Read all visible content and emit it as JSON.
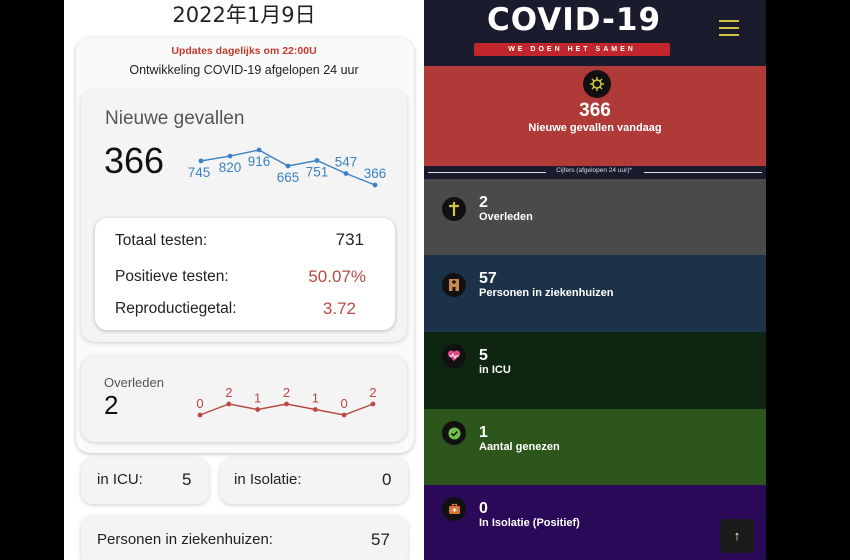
{
  "left": {
    "date": "2022年1月9日",
    "updates": "Updates dagelijks om 22:00U",
    "subtitle": "Ontwikkeling COVID-19 afgelopen 24 uur",
    "nieuwe": {
      "label": "Nieuwe gevallen",
      "value": "366",
      "trend": [
        "745",
        "820",
        "916",
        "665",
        "751",
        "547",
        "366"
      ]
    },
    "tests": {
      "totaal_label": "Totaal testen:",
      "totaal_value": "731",
      "positief_label": "Positieve testen:",
      "positief_value": "50.07%",
      "repro_label": "Reproductiegetal:",
      "repro_value": "3.72"
    },
    "overleden": {
      "label": "Overleden",
      "value": "2",
      "trend": [
        "0",
        "2",
        "1",
        "2",
        "1",
        "0",
        "2"
      ]
    },
    "icu": {
      "label": "in ICU:",
      "value": "5"
    },
    "isolatie": {
      "label": "in Isolatie:",
      "value": "0"
    },
    "ziekenhuis": {
      "label": "Personen in ziekenhuizen:",
      "value": "57"
    },
    "colors": {
      "line_blue": "#3b82c4",
      "line_red": "#b84a45",
      "accent_red": "#c0392b"
    }
  },
  "right": {
    "title": "COVID-19",
    "tagline": "WE DOEN HET SAMEN",
    "hero": {
      "value": "366",
      "label": "Nieuwe gevallen vandaag",
      "icon": "virus-icon",
      "color": "#b03a37"
    },
    "divider": "Cijfers (afgelopen 24 uur)*",
    "stats": [
      {
        "value": "2",
        "label": "Overleden",
        "icon": "cross-icon",
        "color": "#4a4a4a"
      },
      {
        "value": "57",
        "label": "Personen in ziekenhuizen",
        "icon": "hospital-icon",
        "color": "#1c3248"
      },
      {
        "value": "5",
        "label": "in ICU",
        "icon": "heartbeat-icon",
        "color": "#0e2610"
      },
      {
        "value": "1",
        "label": "Aantal genezen",
        "icon": "check-icon",
        "color": "#2d561d"
      },
      {
        "value": "0",
        "label": "In Isolatie (Positief)",
        "icon": "medkit-icon",
        "color": "#2a0a58"
      }
    ],
    "scroll_top": "↑"
  }
}
